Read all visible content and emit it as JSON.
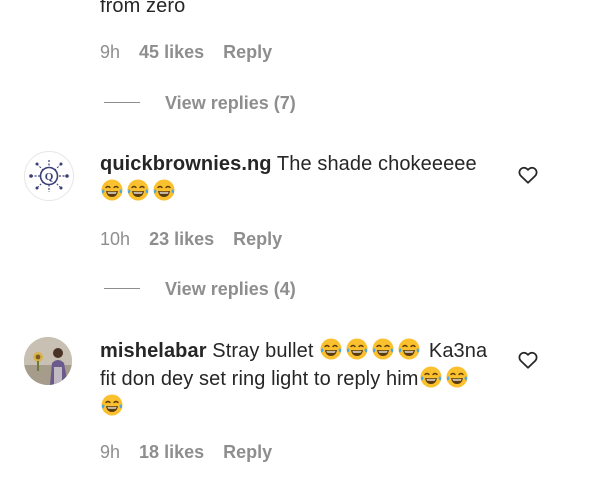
{
  "comments": [
    {
      "text_tail": "from zero",
      "time": "9h",
      "likes": "45 likes",
      "reply": "Reply",
      "view_replies": "View replies (7)"
    },
    {
      "username": "quickbrownies.ng",
      "text": "The shade chokeeeee",
      "emoji": [
        "😂",
        "😂",
        "😂"
      ],
      "time": "10h",
      "likes": "23 likes",
      "reply": "Reply",
      "view_replies": "View replies (4)",
      "avatar_letter": "Q"
    },
    {
      "username": "mishelabar",
      "text_line1": "Stray bullet",
      "emoji_line1": [
        "😂",
        "😂",
        "😂",
        "😂"
      ],
      "text_line1b": "Ka3na",
      "text_line2": "fit don dey set ring light to reply him",
      "emoji_line2": [
        "😂",
        "😂"
      ],
      "emoji_line3": [
        "😂"
      ],
      "time": "9h",
      "likes": "18 likes",
      "reply": "Reply"
    }
  ],
  "colors": {
    "text": "#262626",
    "secondary": "#8e8e8e",
    "emoji_face": "#fbc02d"
  },
  "icons": {
    "like": "heart-outline-icon"
  }
}
